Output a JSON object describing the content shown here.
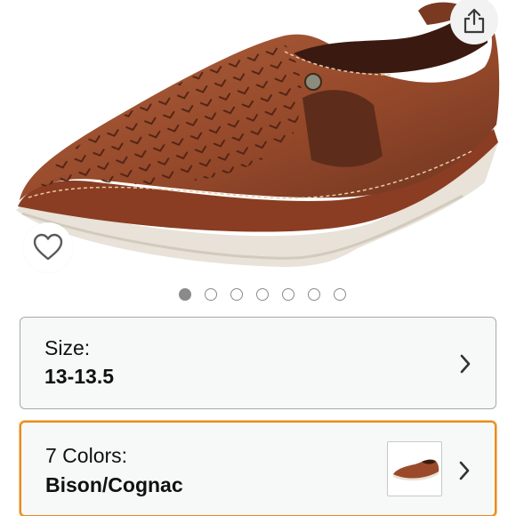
{
  "product": {
    "image_name": "brown-perforated-slip-on-shoe",
    "carousel": {
      "total": 7,
      "active_index": 0
    }
  },
  "size_selector": {
    "label": "Size:",
    "value": "13-13.5"
  },
  "color_selector": {
    "label": "7 Colors:",
    "value": "Bison/Cognac",
    "highlight_color": "#e98c1a"
  },
  "icons": {
    "share": "share-icon",
    "favorite": "heart-icon",
    "chevron": "chevron-right-icon"
  }
}
